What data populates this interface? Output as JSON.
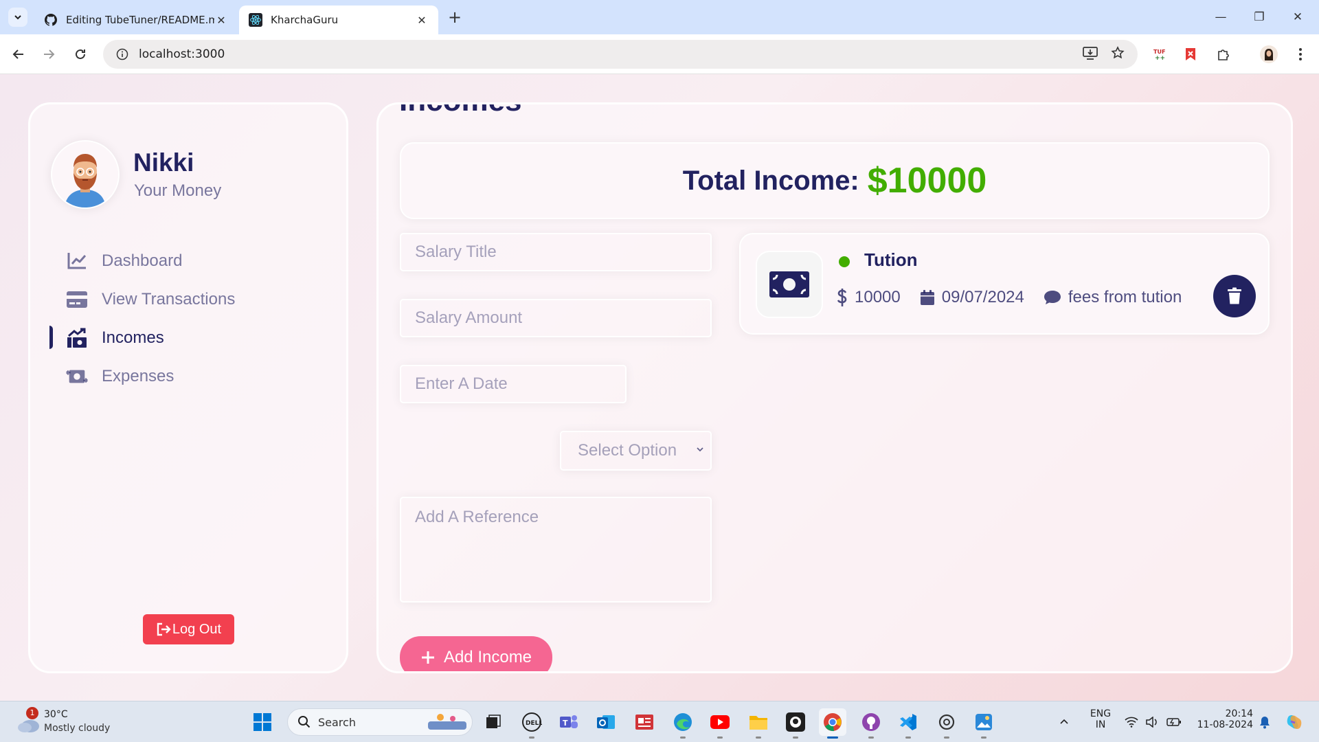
{
  "browser": {
    "tabs": [
      {
        "title": "Editing TubeTuner/README.md",
        "icon": "github-icon"
      },
      {
        "title": "KharchaGuru",
        "icon": "react-icon",
        "active": true
      }
    ],
    "new_tab_label": "+",
    "url": "localhost:3000",
    "window_controls": {
      "minimize": "—",
      "restore": "❐",
      "close": "✕"
    }
  },
  "sidebar": {
    "user_name": "Nikki",
    "user_subtitle": "Your Money",
    "menu": [
      {
        "label": "Dashboard",
        "icon": "chart-line-icon",
        "active": false
      },
      {
        "label": "View Transactions",
        "icon": "credit-card-icon",
        "active": false
      },
      {
        "label": "Incomes",
        "icon": "money-bill-trend-up-icon",
        "active": true
      },
      {
        "label": "Expenses",
        "icon": "money-bill-transfer-icon",
        "active": false
      }
    ],
    "logout_label": "Log Out"
  },
  "main": {
    "title": "Incomes",
    "total_label": "Total Income:",
    "total_value": "$10000",
    "form": {
      "title_placeholder": "Salary Title",
      "amount_placeholder": "Salary Amount",
      "date_placeholder": "Enter A Date",
      "select_value": "Select Option",
      "reference_placeholder": "Add A Reference",
      "submit_label": "Add Income"
    },
    "incomes": [
      {
        "title": "Tution",
        "amount": "10000",
        "date": "09/07/2024",
        "description": "fees from tution",
        "icon": "money-bill-icon"
      }
    ]
  },
  "taskbar": {
    "weather_temp": "30°C",
    "weather_desc": "Mostly cloudy",
    "weather_badge": "1",
    "search_label": "Search",
    "lang_top": "ENG",
    "lang_bottom": "IN",
    "time": "20:14",
    "date": "11-08-2024"
  },
  "colors": {
    "primary": "#222260",
    "green": "#42ad00",
    "pink_button": "#f56692",
    "logout_red": "#f2404f"
  }
}
